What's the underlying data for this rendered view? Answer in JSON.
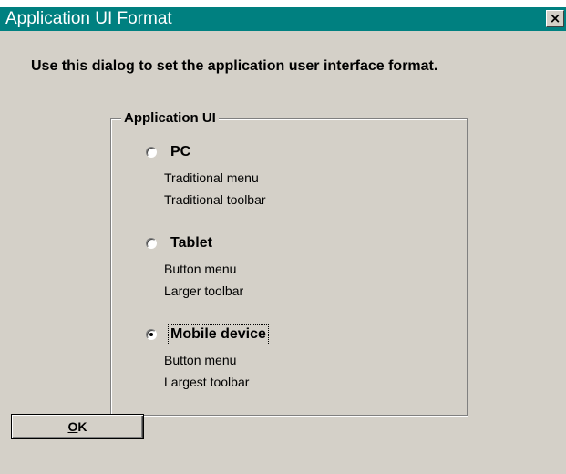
{
  "window": {
    "title": "Application UI Format",
    "close_glyph": "×"
  },
  "instruction": "Use this dialog to set the application user interface format.",
  "group": {
    "label": "Application UI",
    "options": [
      {
        "label": "PC",
        "selected": false,
        "descriptions": [
          "Traditional menu",
          "Traditional toolbar"
        ]
      },
      {
        "label": "Tablet",
        "selected": false,
        "descriptions": [
          "Button menu",
          "Larger toolbar"
        ]
      },
      {
        "label": "Mobile device",
        "selected": true,
        "descriptions": [
          "Button menu",
          "Largest toolbar"
        ]
      }
    ]
  },
  "buttons": {
    "ok_mnemonic": "O",
    "ok_rest": "K"
  },
  "colors": {
    "titlebar": "#008080",
    "dialog_bg": "#d4d0c8"
  }
}
